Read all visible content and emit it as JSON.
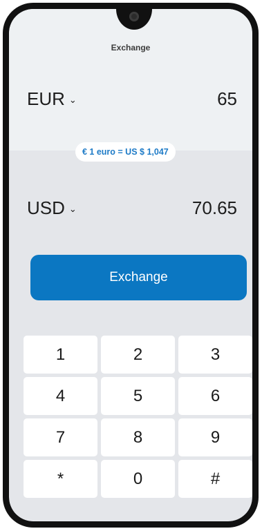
{
  "header": {
    "title": "Exchange"
  },
  "from": {
    "currency": "EUR",
    "amount": "65"
  },
  "to": {
    "currency": "USD",
    "amount": "70.65"
  },
  "rate": {
    "text": "€ 1 euro = US $ 1,047"
  },
  "actions": {
    "exchange_label": "Exchange"
  },
  "keypad": {
    "keys": [
      "1",
      "2",
      "3",
      "4",
      "5",
      "6",
      "7",
      "8",
      "9",
      "*",
      "0",
      "#"
    ]
  },
  "colors": {
    "accent": "#0b77c2",
    "rate_text": "#1e7bc7",
    "top_panel": "#eef1f3",
    "bottom_panel": "#e4e6ea"
  },
  "icons": {
    "chevron": "chevron-down-icon"
  }
}
